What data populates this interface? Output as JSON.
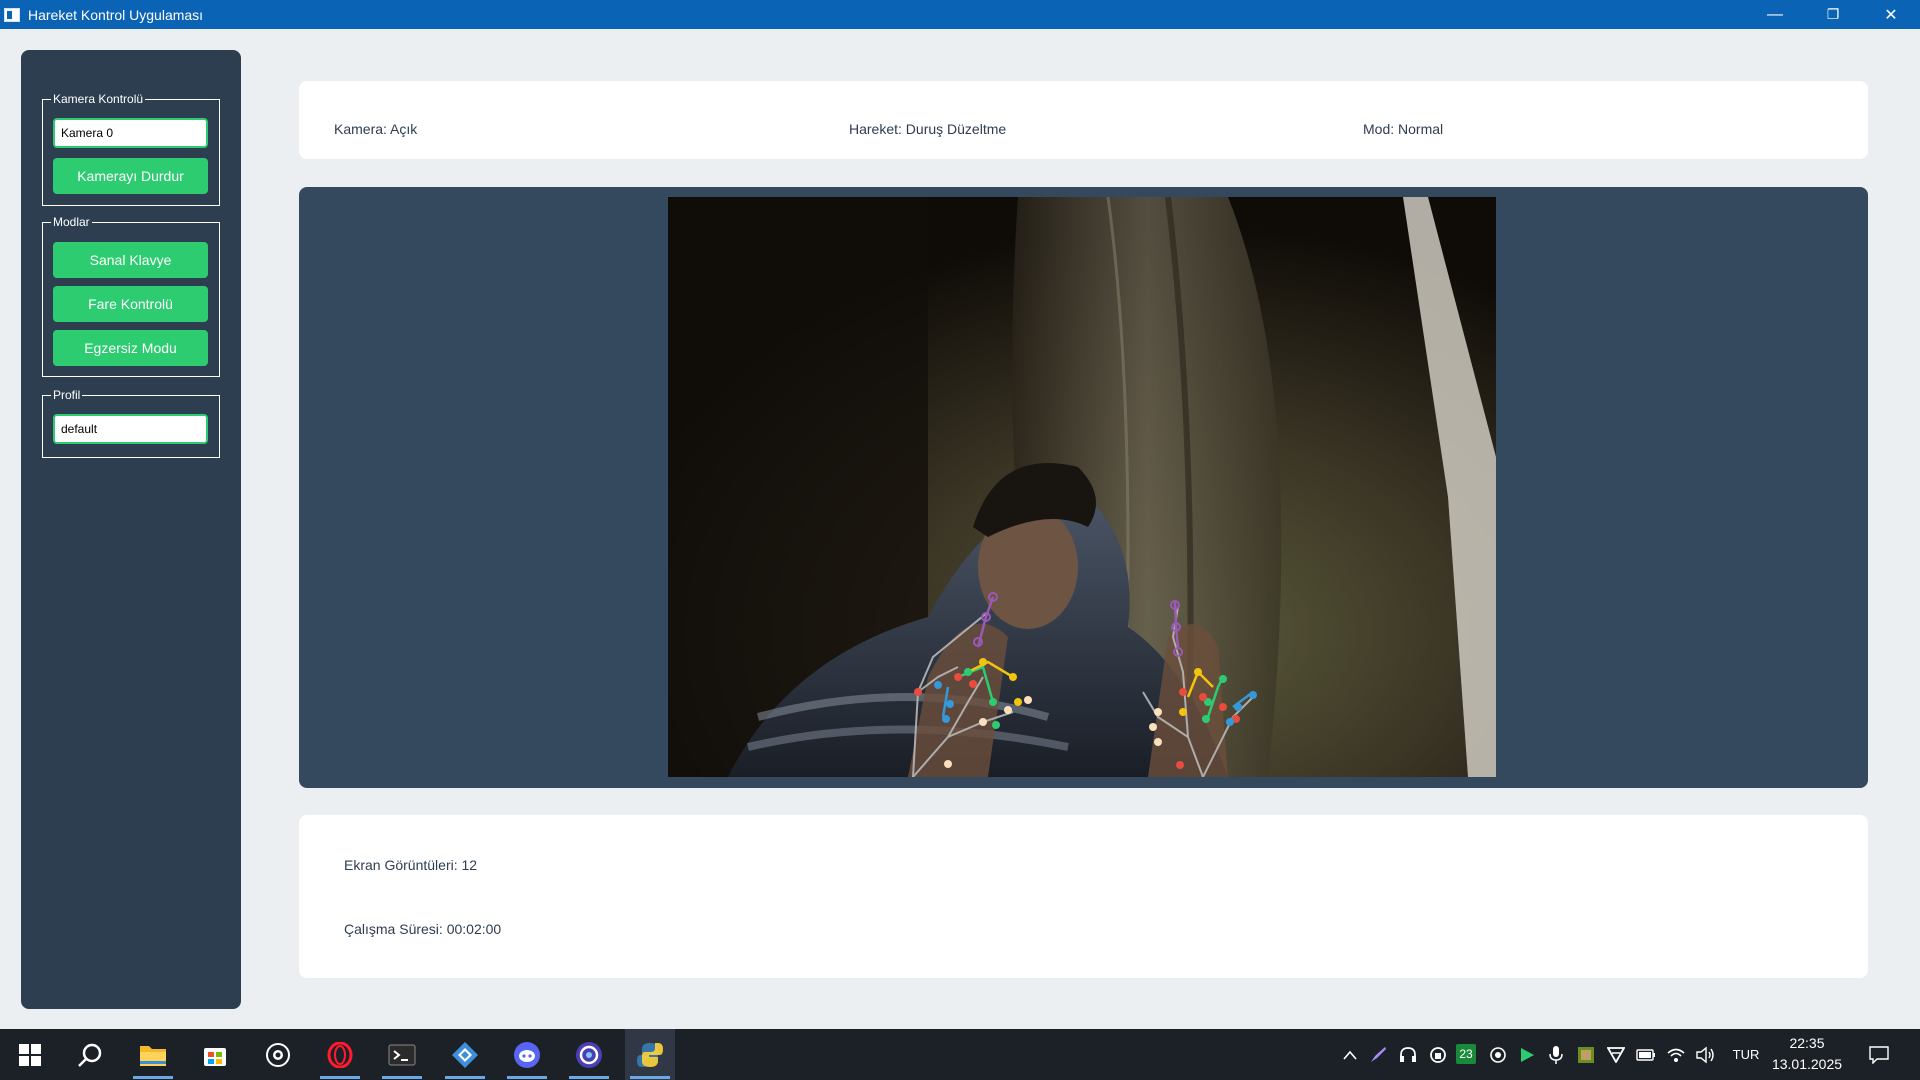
{
  "window": {
    "title": "Hareket Kontrol Uygulaması",
    "minimize_glyph": "—",
    "restore_glyph": "❐",
    "close_glyph": "✕"
  },
  "sidebar": {
    "camera_group": {
      "legend": "Kamera Kontrolü",
      "camera_select": "Kamera 0",
      "stop_button": "Kamerayı Durdur"
    },
    "modes_group": {
      "legend": "Modlar",
      "buttons": [
        "Sanal Klavye",
        "Fare Kontrolü",
        "Egzersiz Modu"
      ]
    },
    "profile_group": {
      "legend": "Profil",
      "profile_value": "default"
    }
  },
  "status": {
    "camera": "Kamera: Açık",
    "gesture": "Hareket: Duruş Düzeltme",
    "mode": "Mod: Normal"
  },
  "stats": {
    "screenshots": "Ekran Görüntüleri: 12",
    "runtime": "Çalışma Süresi: 00:02:00"
  },
  "taskbar": {
    "apps": [
      "start-icon",
      "search-icon",
      "file-explorer-icon",
      "microsoft-store-icon",
      "steam-icon",
      "opera-icon",
      "terminal-icon",
      "network-tool-icon",
      "discord-icon",
      "browser-icon",
      "python-icon"
    ],
    "tray_temp": "23",
    "language": "TUR",
    "time": "22:35",
    "date": "13.01.2025"
  },
  "colors": {
    "titlebar": "#0b63b5",
    "sidebar": "#2c3e50",
    "accent_green": "#2ecc71",
    "video_panel": "#34495e",
    "taskbar": "#1c2128"
  }
}
